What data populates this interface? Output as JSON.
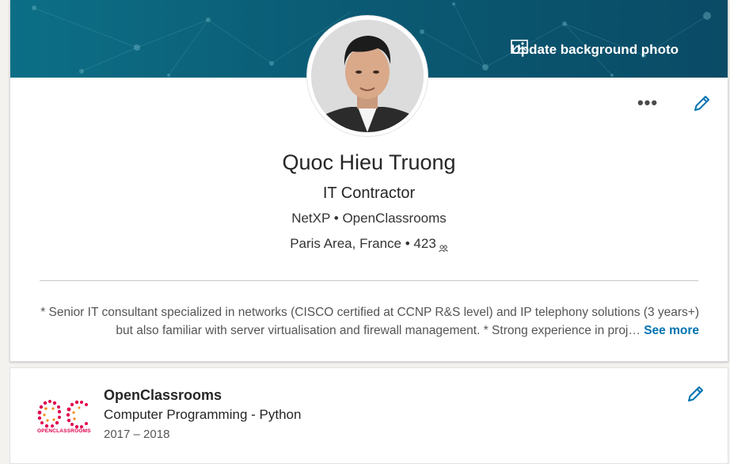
{
  "banner": {
    "update_label": "Update background photo"
  },
  "profile": {
    "name": "Quoc Hieu Truong",
    "headline": "IT Contractor",
    "companies": [
      "NetXP",
      "OpenClassrooms"
    ],
    "location": "Paris Area, France",
    "connections": "423",
    "separator": "•"
  },
  "summary": {
    "text": "* Senior IT consultant specialized in networks (CISCO certified at CCNP R&S level) and IP telephony solutions (3 years+) but also familiar with server virtualisation and firewall management. * Strong experience in proj…",
    "see_more": "See more"
  },
  "education": {
    "logo_text": "OPENCLASSROOMS",
    "school": "OpenClassrooms",
    "degree": "Computer Programming - Python",
    "dates": "2017 – 2018"
  },
  "icons": {
    "banner_photo": "image-icon",
    "more": "more-horizontal-icon",
    "edit": "pencil-icon",
    "connections": "people-icon"
  },
  "colors": {
    "accent": "#0073b1",
    "banner": "#0b5b74",
    "brand_logo": "#e0004d"
  }
}
